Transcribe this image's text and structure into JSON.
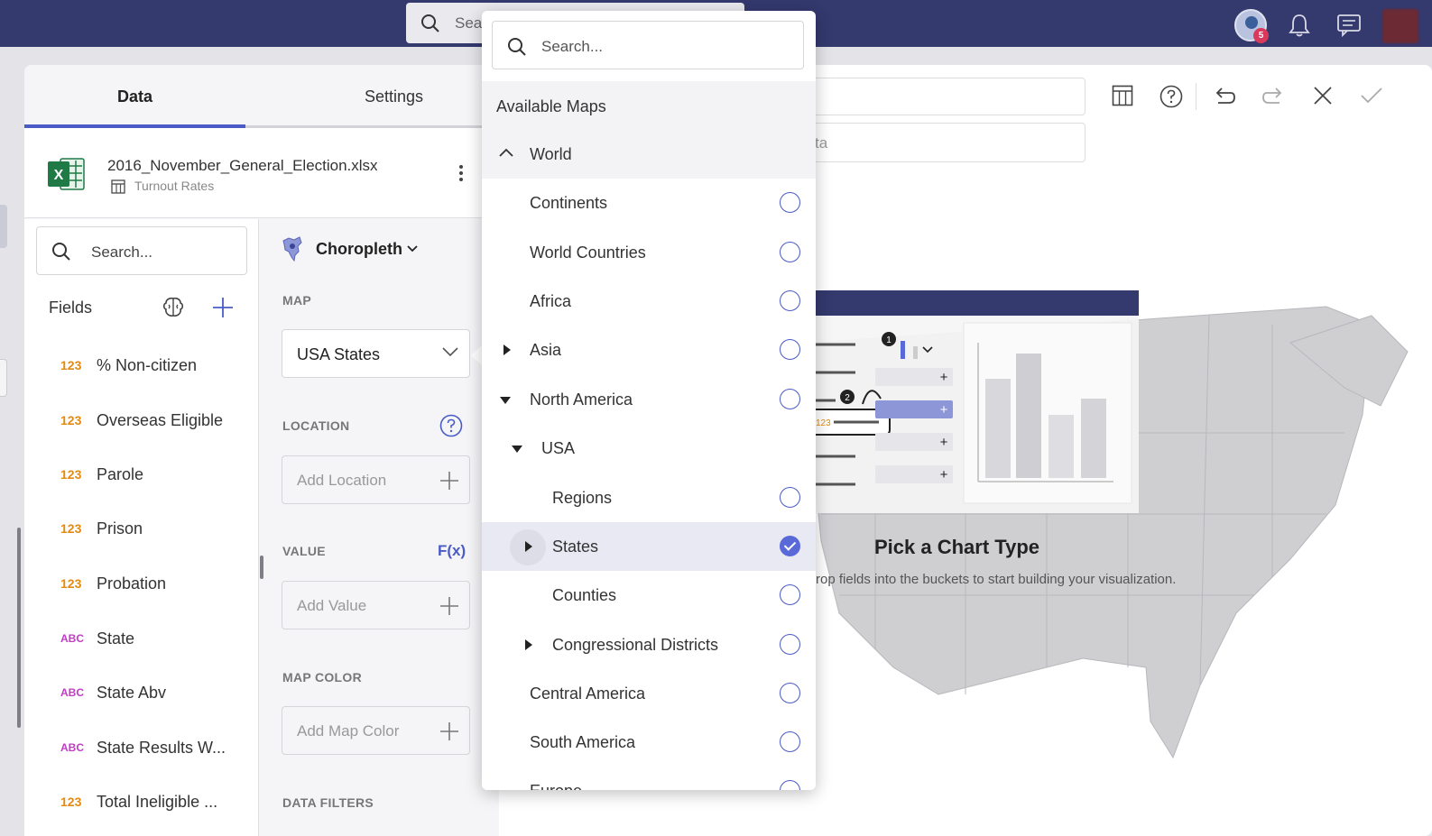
{
  "topbar": {
    "search_placeholder": "Sear",
    "notification_count": "5"
  },
  "tabs": {
    "data": "Data",
    "settings": "Settings"
  },
  "datasource": {
    "file_name": "2016_November_General_Election.xlsx",
    "sheet": "Turnout Rates"
  },
  "fields_panel": {
    "search_placeholder": "Search...",
    "label": "Fields",
    "fields": [
      {
        "type": "123",
        "name": "% Non-citizen"
      },
      {
        "type": "123",
        "name": "Overseas Eligible"
      },
      {
        "type": "123",
        "name": "Parole"
      },
      {
        "type": "123",
        "name": "Prison"
      },
      {
        "type": "123",
        "name": "Probation"
      },
      {
        "type": "ABC",
        "name": "State"
      },
      {
        "type": "ABC",
        "name": "State Abv"
      },
      {
        "type": "ABC",
        "name": "State Results W..."
      },
      {
        "type": "123",
        "name": "Total Ineligible ..."
      }
    ]
  },
  "buckets": {
    "chart_type": "Choropleth",
    "map_label": "MAP",
    "map_value": "USA States",
    "location_label": "LOCATION",
    "location_placeholder": "Add Location",
    "value_label": "VALUE",
    "fx_label": "F(x)",
    "value_placeholder": "Add Value",
    "map_color_label": "MAP COLOR",
    "map_color_placeholder": "Add Map Color",
    "data_filters_label": "DATA FILTERS"
  },
  "canvas": {
    "title_input_value": "ta",
    "illus_step1": "1",
    "illus_step2": "2",
    "illus_numfield": "123",
    "pick_title": "Pick a Chart Type",
    "pick_subtitle": "rop fields into the buckets to start building your visualization."
  },
  "map_dropdown": {
    "search_placeholder": "Search...",
    "header": "Available Maps",
    "items": [
      {
        "label": "World"
      },
      {
        "label": "Continents"
      },
      {
        "label": "World Countries"
      },
      {
        "label": "Africa"
      },
      {
        "label": "Asia"
      },
      {
        "label": "North America"
      },
      {
        "label": "USA"
      },
      {
        "label": "Regions"
      },
      {
        "label": "States",
        "selected": true
      },
      {
        "label": "Counties"
      },
      {
        "label": "Congressional Districts"
      },
      {
        "label": "Central America"
      },
      {
        "label": "South America"
      },
      {
        "label": "Europe"
      }
    ]
  },
  "colors": {
    "topbar": "#34396e",
    "accent": "#4a5bc6",
    "number_type": "#e38a10",
    "text_type": "#c03ec4"
  }
}
